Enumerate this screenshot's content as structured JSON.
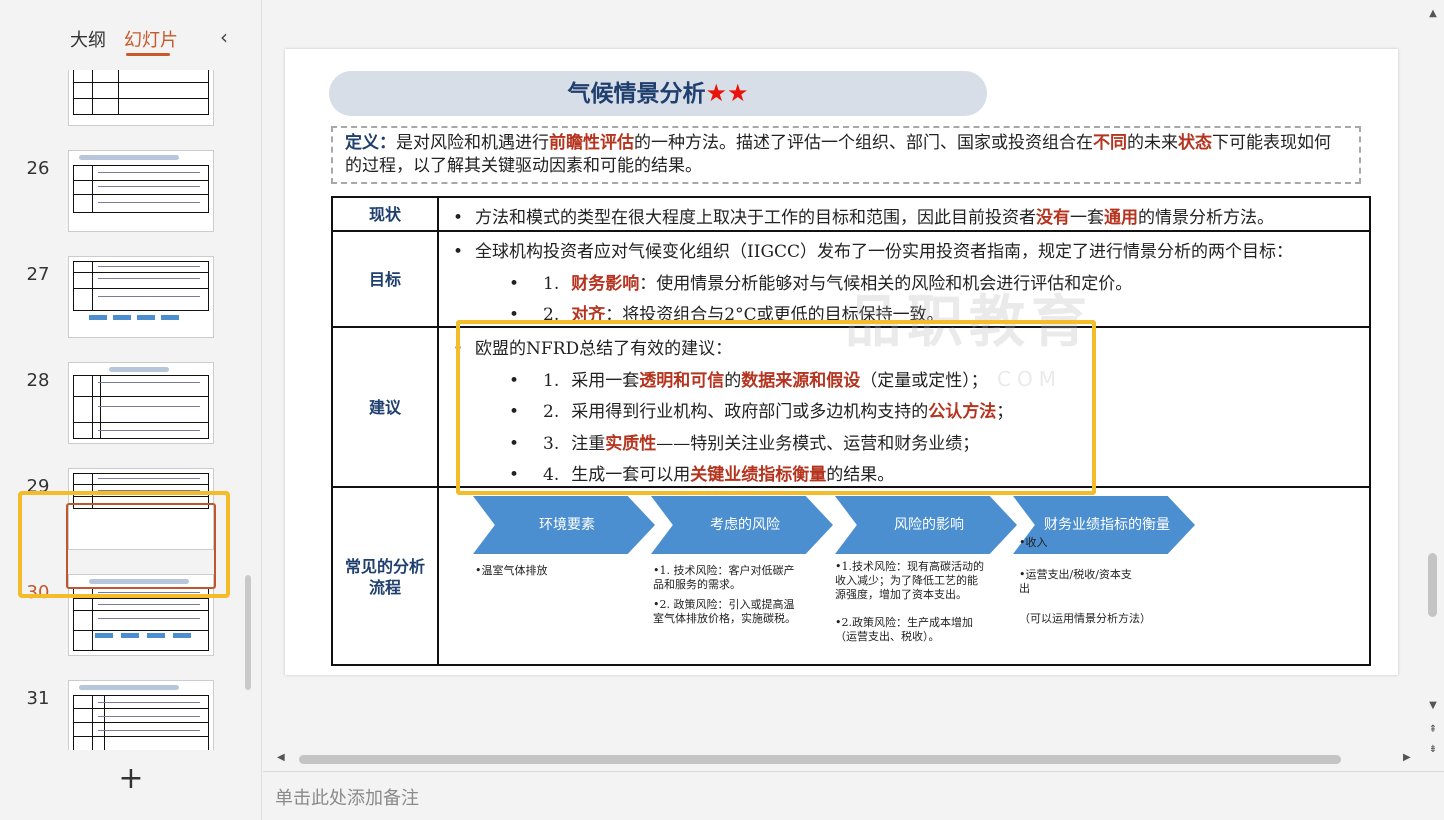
{
  "left_panel": {
    "tabs": {
      "outline": "大纲",
      "slides": "幻灯片"
    },
    "collapse_icon": "‹",
    "add_icon": "+",
    "slide_numbers": [
      "26",
      "27",
      "28",
      "29",
      "30",
      "31"
    ],
    "selected_slide": "30"
  },
  "slide": {
    "title": "气候情景分析",
    "stars": "★★",
    "definition": {
      "label": "定义：",
      "t1": "是对风险和机遇进行",
      "h1": "前瞻性评估",
      "t2": "的一种方法。描述了评估一个组织、部门、国家或投资组合在",
      "h2": "不同",
      "t3": "的未来",
      "h3": "状态",
      "t4": "下可能表现如何的过程，以了解其关键驱动因素和可能的结果。"
    },
    "rows": {
      "status": {
        "label": "现状",
        "t1": "方法和模式的类型在很大程度上取决于工作的目标和范围，因此目前投资者",
        "h1": "没有",
        "t2": "一套",
        "h2": "通用",
        "t3": "的情景分析方法。"
      },
      "goal": {
        "label": "目标",
        "intro": "全球机构投资者应对气候变化组织（IIGCC）发布了一份实用投资者指南，规定了进行情景分析的两个目标：",
        "item1_num": "1.",
        "item1_h": "财务影响",
        "item1_t": "：使用情景分析能够对与气候相关的风险和机会进行评估和定价。",
        "item2_num": "2.",
        "item2_h": "对齐",
        "item2_t": "：将投资组合与2°C或更低的目标保持一致。"
      },
      "advice": {
        "label": "建议",
        "intro": "欧盟的NFRD总结了有效的建议：",
        "i1_num": "1.",
        "i1_t1": "采用一套",
        "i1_h1": "透明和可信",
        "i1_t2": "的",
        "i1_h2": "数据来源和假设",
        "i1_t3": "（定量或定性）；",
        "i2_num": "2.",
        "i2_t1": "采用得到行业机构、政府部门或多边机构支持的",
        "i2_h1": "公认方法",
        "i2_t2": "；",
        "i3_num": "3.",
        "i3_t1": "注重",
        "i3_h1": "实质性",
        "i3_t2": "——特别关注业务模式、运营和财务业绩；",
        "i4_num": "4.",
        "i4_t1": "生成一套可以用",
        "i4_h1": "关键业绩指标衡量",
        "i4_t2": "的结果。"
      },
      "flow": {
        "label": "常见的分析流程",
        "steps": [
          "环境要素",
          "考虑的风险",
          "风险的影响",
          "财务业绩指标的衡量"
        ],
        "col1": "•温室气体排放",
        "col2a": "•1.  技术风险：客户对低碳产品和服务的需求。",
        "col2b": "•2.  政策风险：引入或提高温室气体排放价格，实施碳税。",
        "col3a": "•1.技术风险：现有高碳活动的收入减少；为了降低工艺的能源强度，增加了资本支出。",
        "col3b": "•2.政策风险：生产成本增加（运营支出、税收）。",
        "col4a": "•收入",
        "col4b": "•运营支出/税收/资本支出",
        "col4c": "（可以运用情景分析方法）"
      }
    },
    "watermark": "品职教育",
    "watermark_sub": "COM"
  },
  "notes": {
    "placeholder": "单击此处添加备注"
  },
  "colors": {
    "accent": "#c55a2b",
    "highlight": "#f5bc2a",
    "chevron": "#4b8fd0",
    "title_bar": "#d7dee8",
    "title_text": "#1f3f6e",
    "red_text": "#b5341f"
  }
}
